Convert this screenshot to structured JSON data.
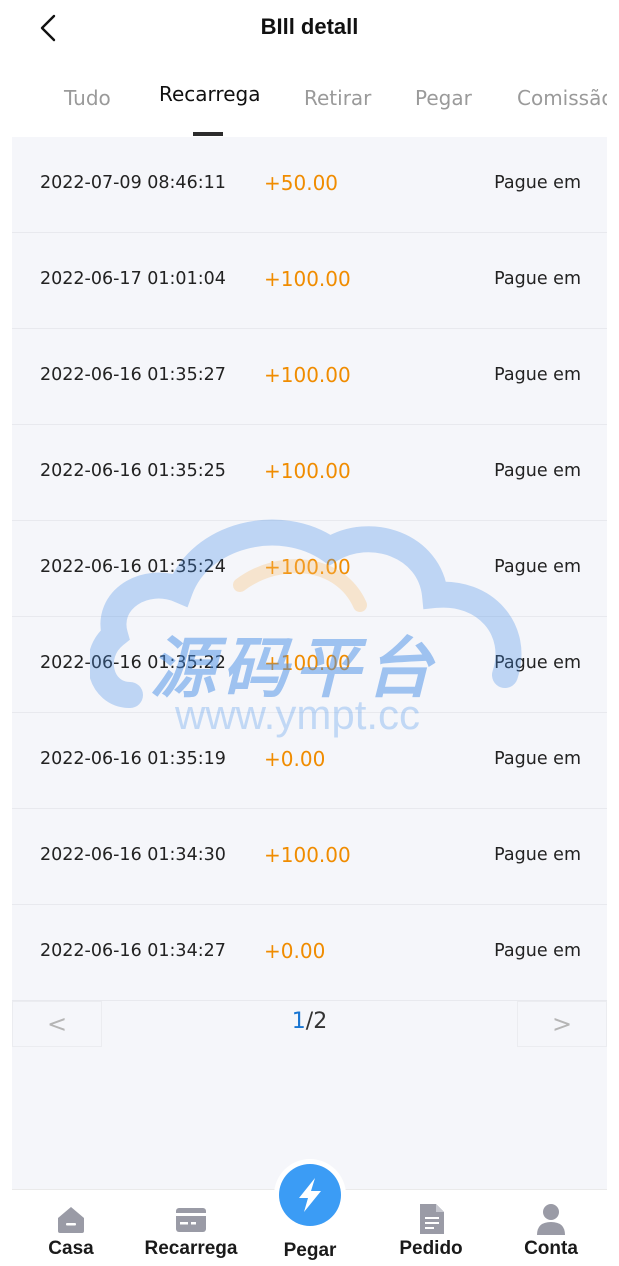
{
  "header": {
    "title": "BIll detall"
  },
  "tabs": [
    {
      "label": "Tudo"
    },
    {
      "label": "Recarrega"
    },
    {
      "label": "Retirar"
    },
    {
      "label": "Pegar"
    },
    {
      "label": "Comissão"
    }
  ],
  "active_tab": "Recarrega",
  "records": [
    {
      "date": "2022-07-09 08:46:11",
      "amount": "+50.00",
      "status": "Pague em"
    },
    {
      "date": "2022-06-17 01:01:04",
      "amount": "+100.00",
      "status": "Pague em"
    },
    {
      "date": "2022-06-16 01:35:27",
      "amount": "+100.00",
      "status": "Pague em"
    },
    {
      "date": "2022-06-16 01:35:25",
      "amount": "+100.00",
      "status": "Pague em"
    },
    {
      "date": "2022-06-16 01:35:24",
      "amount": "+100.00",
      "status": "Pague em"
    },
    {
      "date": "2022-06-16 01:35:22",
      "amount": "+100.00",
      "status": "Pague em"
    },
    {
      "date": "2022-06-16 01:35:19",
      "amount": "+0.00",
      "status": "Pague em"
    },
    {
      "date": "2022-06-16 01:34:30",
      "amount": "+100.00",
      "status": "Pague em"
    },
    {
      "date": "2022-06-16 01:34:27",
      "amount": "+0.00",
      "status": "Pague em"
    }
  ],
  "pager": {
    "prev": "<",
    "next": ">",
    "current": "1",
    "separator": "/",
    "total": "2"
  },
  "watermark": {
    "text": "源码平台",
    "url": "www.ympt.cc"
  },
  "tabbar": {
    "home": "Casa",
    "recharge": "Recarrega",
    "grab": "Pegar",
    "orders": "Pedido",
    "account": "Conta"
  },
  "colors": {
    "amount": "#f08c00",
    "pager_current": "#1976d2",
    "center_button": "#3b9cf5",
    "tab_icon": "#9a9ba6"
  },
  "icons": {
    "back": "chevron-left-icon",
    "home": "house-icon",
    "recharge": "card-icon",
    "grab": "lightning-icon",
    "orders": "document-icon",
    "account": "person-icon"
  }
}
